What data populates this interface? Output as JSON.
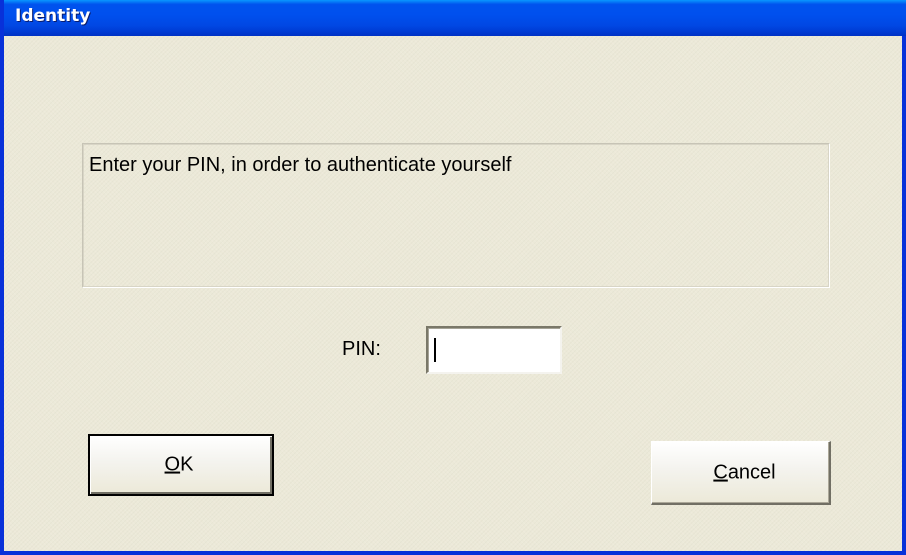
{
  "window": {
    "title": "Identity"
  },
  "dialog": {
    "message": "Enter your PIN, in order to authenticate yourself",
    "pin_label": "PIN:",
    "pin_value": ""
  },
  "buttons": {
    "ok": {
      "mnemonic": "O",
      "rest": "K"
    },
    "cancel": {
      "mnemonic": "C",
      "rest": "ancel"
    }
  },
  "colors": {
    "title_bar": "#0053ee",
    "window_face": "#ece9d8"
  }
}
